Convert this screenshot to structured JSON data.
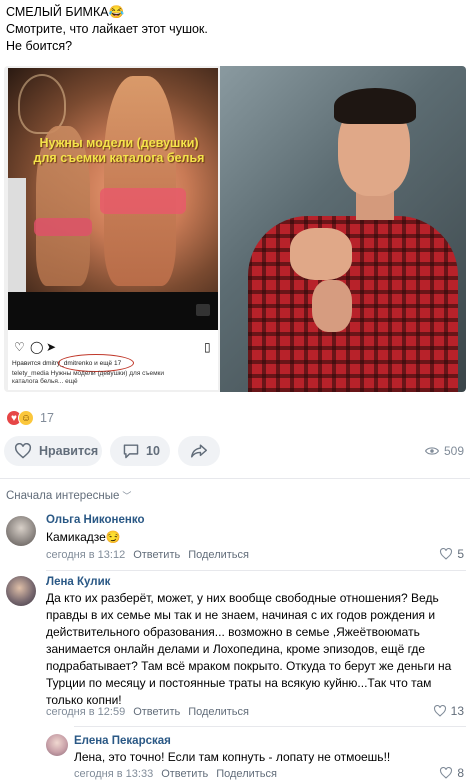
{
  "post": {
    "line1": "СМЕЛЫЙ БИМКА😂",
    "line2": "Смотрите, что лайкает этот чушок.",
    "line3": "Не боится?"
  },
  "media": {
    "left_image": {
      "caption_line1": "Нужны модели (девушки)",
      "caption_line2": "для съемки каталога белья",
      "likes_line": "Нравится dmitry_dmitrenko и ещё 17",
      "desc_line1": "telety_media Нужны модели (девушки) для съемки",
      "desc_line2": "каталога белья... ещё"
    }
  },
  "reactions": {
    "count": "17"
  },
  "actions": {
    "like_label": "Нравится",
    "comment_count": "10",
    "views": "509"
  },
  "comments_sort": "Сначала интересные",
  "comments": [
    {
      "author": "Ольга Никоненко",
      "text": "Камикадзе😏",
      "time": "сегодня в 13:12",
      "reply": "Ответить",
      "share": "Поделиться",
      "likes": "5"
    },
    {
      "author": "Лена Кулик",
      "text_lines": [
        "Да кто их разберёт, может, у них вообще свободные отношения? Ведь",
        "правды в их семье мы так и не знаем, начиная с их годов рождения и",
        "действительного образования... возможно в семье ,Яжеётвоюмать",
        "занимается онлайн делами и Лохопедина, кроме эпизодов, ещё где",
        "подрабатывает? Там всё мраком покрыто. Откуда то берут же деньги на",
        "Турции по месяцу и постоянные траты на всякую куйню...Так что там",
        "только копни!"
      ],
      "time": "сегодня в 12:59",
      "reply": "Ответить",
      "share": "Поделиться",
      "likes": "13"
    },
    {
      "author": "Елена Пекарская",
      "text": "Лена, это точно! Если там копнуть - лопату не отмоешь!!",
      "time": "сегодня в 13:33",
      "reply": "Ответить",
      "share": "Поделиться",
      "likes": "8"
    }
  ],
  "colors": {
    "link": "#2a5885",
    "muted": "#818c99",
    "button_bg": "#f0f2f5",
    "heart": "#e64646"
  }
}
